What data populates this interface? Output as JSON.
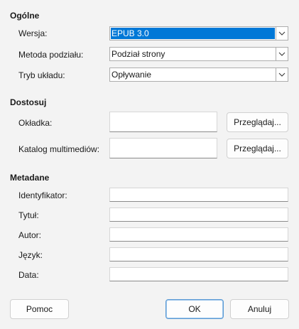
{
  "general": {
    "title": "Ogólne",
    "version_label": "Wersja:",
    "version_value": "EPUB 3.0",
    "split_label": "Metoda podziału:",
    "split_value": "Podział strony",
    "layout_label": "Tryb układu:",
    "layout_value": "Opływanie"
  },
  "customize": {
    "title": "Dostosuj",
    "cover_label": "Okładka:",
    "media_label": "Katalog multimediów:",
    "browse_label": "Przeglądaj..."
  },
  "metadata": {
    "title": "Metadane",
    "fields": [
      {
        "label": "Identyfikator:",
        "value": ""
      },
      {
        "label": "Tytuł:",
        "value": ""
      },
      {
        "label": "Autor:",
        "value": ""
      },
      {
        "label": "Język:",
        "value": ""
      },
      {
        "label": "Data:",
        "value": ""
      }
    ]
  },
  "footer": {
    "help_label": "Pomoc",
    "ok_label": "OK",
    "cancel_label": "Anuluj"
  }
}
